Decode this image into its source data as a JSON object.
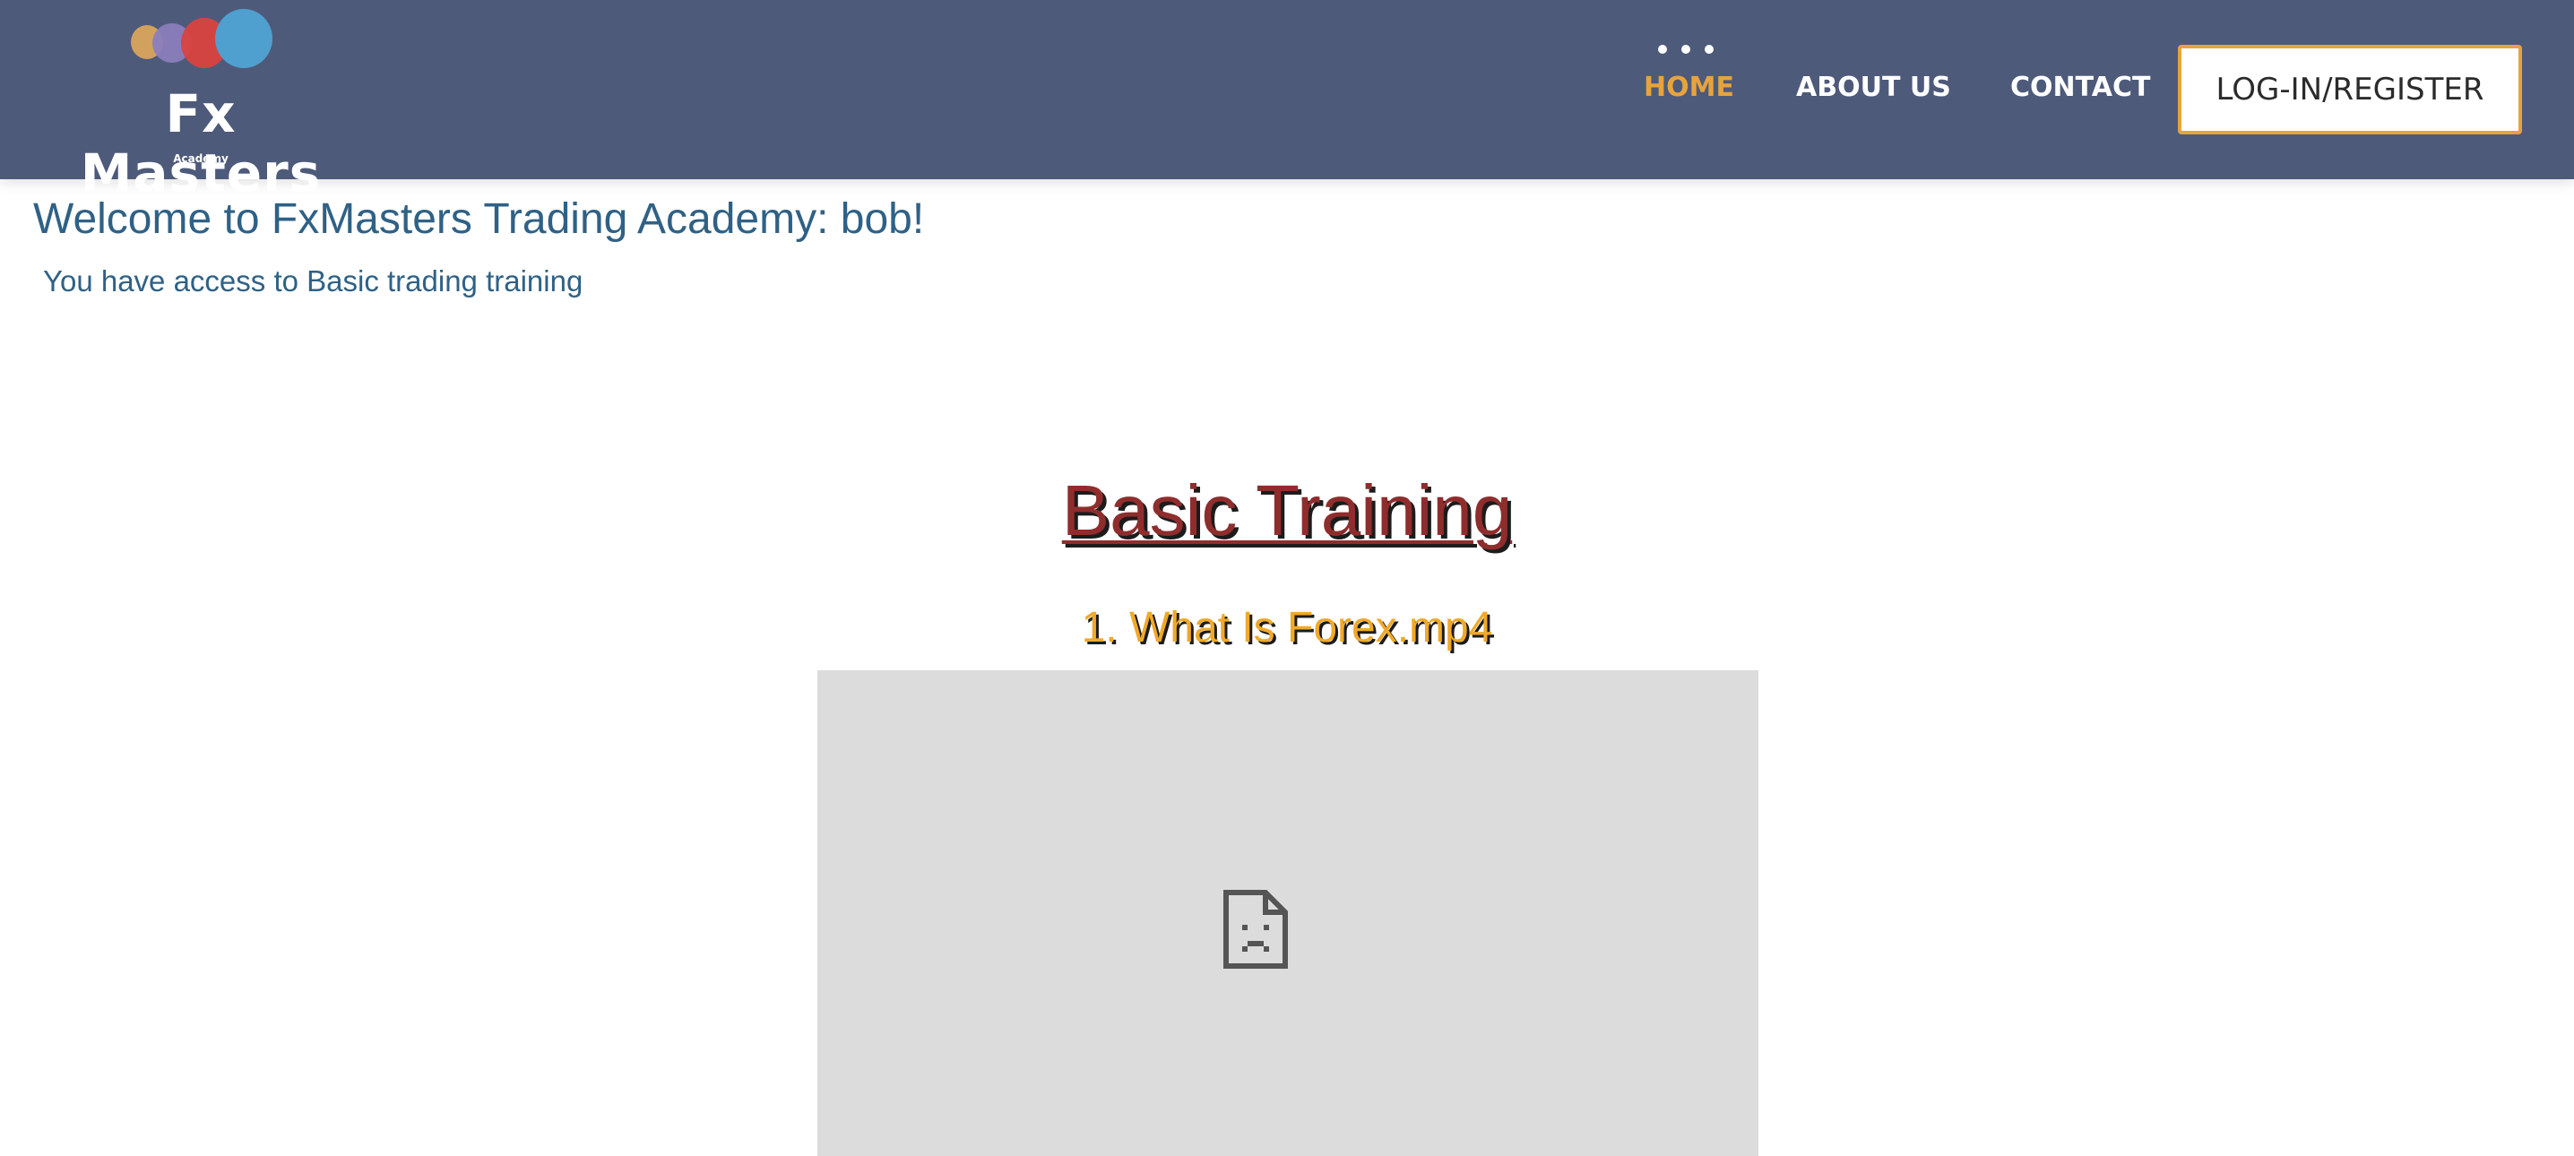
{
  "header": {
    "logo": {
      "brand": "Fx Masters",
      "subtitle": "Academy",
      "colors": [
        "#d8a55c",
        "#8b7ebc",
        "#d9433f",
        "#4f9fcf"
      ]
    },
    "nav": {
      "menu_icon": "more-dots-icon",
      "items": [
        {
          "label": "HOME",
          "active": true
        },
        {
          "label": "ABOUT US",
          "active": false
        },
        {
          "label": "CONTACT",
          "active": false
        }
      ],
      "login_label": "LOG-IN/REGISTER"
    },
    "colors": {
      "background": "#4e5a7a",
      "accent": "#e8a33d"
    }
  },
  "main": {
    "welcome": "Welcome to FxMasters Trading Academy: bob!",
    "access_note": "You have access to Basic trading training",
    "section_title": "Basic Training",
    "video": {
      "title": "1. What Is Forex.mp4",
      "placeholder_icon": "broken-file-icon"
    }
  }
}
